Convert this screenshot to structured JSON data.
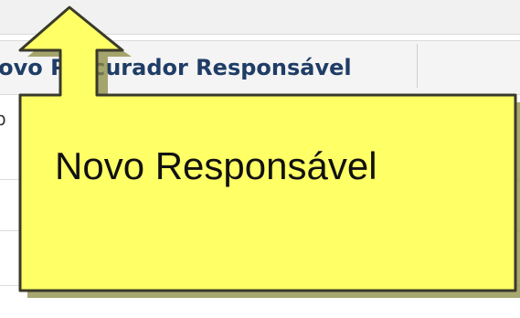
{
  "table": {
    "column_header": "Novo Procurador Responsável",
    "row_fragment": "p"
  },
  "callout": {
    "label": "Novo Responsável",
    "fill_color": "#ffff66",
    "border_color": "#3a3a2a",
    "shadow_color": "#8a8a40"
  }
}
